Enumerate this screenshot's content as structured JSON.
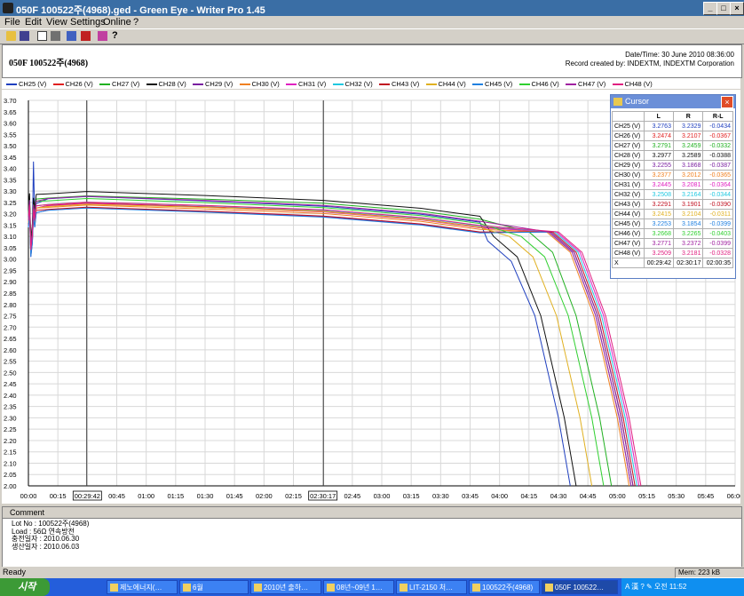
{
  "window": {
    "title": "050F 100522주(4968).ged - Green Eye - Writer Pro 1.45",
    "controls": [
      "_",
      "□",
      "×"
    ]
  },
  "menu": [
    "File",
    "Edit",
    "View",
    "Settings",
    "Online",
    "?"
  ],
  "toolbar_icons": [
    "open-icon",
    "save-icon",
    "preview-icon",
    "print-icon",
    "table-icon",
    "chart-icon",
    "eraser-icon",
    "help-icon"
  ],
  "header": {
    "record_name": "050F 100522주(4968)",
    "datetime": "Date/Time: 30 June 2010 08:36:00",
    "created_by": "Record created by: INDEXTM, INDEXTM Corporation"
  },
  "legend": [
    {
      "name": "CH25 (V)",
      "color": "#1f3fbf"
    },
    {
      "name": "CH26 (V)",
      "color": "#e02020"
    },
    {
      "name": "CH27 (V)",
      "color": "#20b020"
    },
    {
      "name": "CH28 (V)",
      "color": "#101010"
    },
    {
      "name": "CH29 (V)",
      "color": "#7a1fa0"
    },
    {
      "name": "CH30 (V)",
      "color": "#f08020"
    },
    {
      "name": "CH31 (V)",
      "color": "#e020c0"
    },
    {
      "name": "CH32 (V)",
      "color": "#20c8e0"
    },
    {
      "name": "CH43 (V)",
      "color": "#c01020"
    },
    {
      "name": "CH44 (V)",
      "color": "#e0b020"
    },
    {
      "name": "CH45 (V)",
      "color": "#2080e0"
    },
    {
      "name": "CH46 (V)",
      "color": "#30d030"
    },
    {
      "name": "CH47 (V)",
      "color": "#a020a0"
    },
    {
      "name": "CH48 (V)",
      "color": "#e02080"
    }
  ],
  "chart_data": {
    "type": "line",
    "x_ticks": [
      "00:00",
      "00:15",
      "00:29:42",
      "00:45",
      "01:00",
      "01:15",
      "01:30",
      "01:45",
      "02:00",
      "02:15",
      "02:30:17",
      "02:45",
      "03:00",
      "03:15",
      "03:30",
      "03:45",
      "04:00",
      "04:15",
      "04:30",
      "04:45",
      "05:00",
      "05:15",
      "05:30",
      "05:45",
      "06:00"
    ],
    "y_ticks": [
      "3.70",
      "3.65",
      "3.60",
      "3.55",
      "3.50",
      "3.45",
      "3.40",
      "3.35",
      "3.30",
      "3.25",
      "3.20",
      "3.15",
      "3.10",
      "3.05",
      "3.00",
      "2.95",
      "2.90",
      "2.85",
      "2.80",
      "2.75",
      "2.70",
      "2.65",
      "2.60",
      "2.55",
      "2.50",
      "2.45",
      "2.40",
      "2.35",
      "2.30",
      "2.25",
      "2.20",
      "2.15",
      "2.10",
      "2.05",
      "2.00"
    ],
    "ylim": [
      2.0,
      3.7
    ],
    "xlim_minutes": [
      0,
      360
    ],
    "cursor_L": "00:29:42",
    "cursor_R": "02:30:17",
    "series": [
      {
        "name": "CH25 (V)",
        "color": "#1f3fbf",
        "start": 3.23,
        "at30": 3.276,
        "at150": 3.233,
        "knee": 3.08,
        "end_min": 276
      },
      {
        "name": "CH26 (V)",
        "color": "#e02020",
        "start": 3.21,
        "at30": 3.247,
        "at150": 3.211,
        "knee": 3.12,
        "end_min": 308
      },
      {
        "name": "CH27 (V)",
        "color": "#20b020",
        "start": 3.25,
        "at30": 3.279,
        "at150": 3.246,
        "knee": 3.12,
        "end_min": 297
      },
      {
        "name": "CH28 (V)",
        "color": "#101010",
        "start": 3.27,
        "at30": 3.298,
        "at150": 3.259,
        "knee": 3.1,
        "end_min": 279
      },
      {
        "name": "CH29 (V)",
        "color": "#7a1fa0",
        "start": 3.19,
        "at30": 3.226,
        "at150": 3.187,
        "knee": 3.12,
        "end_min": 308
      },
      {
        "name": "CH30 (V)",
        "color": "#f08020",
        "start": 3.21,
        "at30": 3.238,
        "at150": 3.201,
        "knee": 3.12,
        "end_min": 306
      },
      {
        "name": "CH31 (V)",
        "color": "#e020c0",
        "start": 3.21,
        "at30": 3.245,
        "at150": 3.208,
        "knee": 3.12,
        "end_min": 311
      },
      {
        "name": "CH32 (V)",
        "color": "#20c8e0",
        "start": 3.22,
        "at30": 3.251,
        "at150": 3.216,
        "knee": 3.12,
        "end_min": 310
      },
      {
        "name": "CH43 (V)",
        "color": "#c01020",
        "start": 3.2,
        "at30": 3.229,
        "at150": 3.19,
        "knee": 3.12,
        "end_min": 309
      },
      {
        "name": "CH44 (V)",
        "color": "#e0b020",
        "start": 3.21,
        "at30": 3.242,
        "at150": 3.21,
        "knee": 3.1,
        "end_min": 287
      },
      {
        "name": "CH45 (V)",
        "color": "#2080e0",
        "start": 3.19,
        "at30": 3.225,
        "at150": 3.185,
        "knee": 3.12,
        "end_min": 307
      },
      {
        "name": "CH46 (V)",
        "color": "#30d030",
        "start": 3.24,
        "at30": 3.267,
        "at150": 3.227,
        "knee": 3.1,
        "end_min": 293
      },
      {
        "name": "CH47 (V)",
        "color": "#a020a0",
        "start": 3.24,
        "at30": 3.277,
        "at150": 3.237,
        "knee": 3.12,
        "end_min": 307
      },
      {
        "name": "CH48 (V)",
        "color": "#e02080",
        "start": 3.22,
        "at30": 3.251,
        "at150": 3.218,
        "knee": 3.12,
        "end_min": 312
      }
    ]
  },
  "cursor_panel": {
    "title": "Cursor",
    "headers": [
      "",
      "L",
      "R",
      "R-L"
    ],
    "rows": [
      {
        "ch": "CH25 (V)",
        "l": "3.2763",
        "r": "3.2329",
        "d": "-0.0434",
        "color": "#1f3fbf"
      },
      {
        "ch": "CH26 (V)",
        "l": "3.2474",
        "r": "3.2107",
        "d": "-0.0367",
        "color": "#e02020"
      },
      {
        "ch": "CH27 (V)",
        "l": "3.2791",
        "r": "3.2459",
        "d": "-0.0332",
        "color": "#20b020"
      },
      {
        "ch": "CH28 (V)",
        "l": "3.2977",
        "r": "3.2589",
        "d": "-0.0388",
        "color": "#101010"
      },
      {
        "ch": "CH29 (V)",
        "l": "3.2255",
        "r": "3.1868",
        "d": "-0.0387",
        "color": "#7a1fa0"
      },
      {
        "ch": "CH30 (V)",
        "l": "3.2377",
        "r": "3.2012",
        "d": "-0.0365",
        "color": "#f08020"
      },
      {
        "ch": "CH31 (V)",
        "l": "3.2445",
        "r": "3.2081",
        "d": "-0.0364",
        "color": "#e020c0"
      },
      {
        "ch": "CH32 (V)",
        "l": "3.2508",
        "r": "3.2164",
        "d": "-0.0344",
        "color": "#20c8e0"
      },
      {
        "ch": "CH43 (V)",
        "l": "3.2291",
        "r": "3.1901",
        "d": "-0.0390",
        "color": "#c01020"
      },
      {
        "ch": "CH44 (V)",
        "l": "3.2415",
        "r": "3.2104",
        "d": "-0.0311",
        "color": "#e0b020"
      },
      {
        "ch": "CH45 (V)",
        "l": "3.2253",
        "r": "3.1854",
        "d": "-0.0399",
        "color": "#2080e0"
      },
      {
        "ch": "CH46 (V)",
        "l": "3.2668",
        "r": "3.2265",
        "d": "-0.0403",
        "color": "#30d030"
      },
      {
        "ch": "CH47 (V)",
        "l": "3.2771",
        "r": "3.2372",
        "d": "-0.0399",
        "color": "#a020a0"
      },
      {
        "ch": "CH48 (V)",
        "l": "3.2509",
        "r": "3.2181",
        "d": "-0.0328",
        "color": "#e02080"
      },
      {
        "ch": "X",
        "l": "00:29:42",
        "r": "02:30:17",
        "d": "02:00:35",
        "color": "#000000"
      }
    ]
  },
  "comment": {
    "label": "Comment",
    "lines": [
      "Lot No : 100522주(4968)",
      "Load : 56Ω 연속방전",
      "충전일자 : 2010.06.30",
      "생산일자 : 2010.06.03"
    ]
  },
  "status": {
    "text": "Ready",
    "memory": "Mem: 223 kB"
  },
  "taskbar": {
    "start": "시작",
    "tasks": [
      "제노에너지(…",
      "6월",
      "2010년 출하…",
      "08년~09년 1…",
      "LIT-2150 처…",
      "100522주(4968)",
      "050F 100522…"
    ],
    "tray": "A 漢 ? ✎  오전 11:52"
  }
}
